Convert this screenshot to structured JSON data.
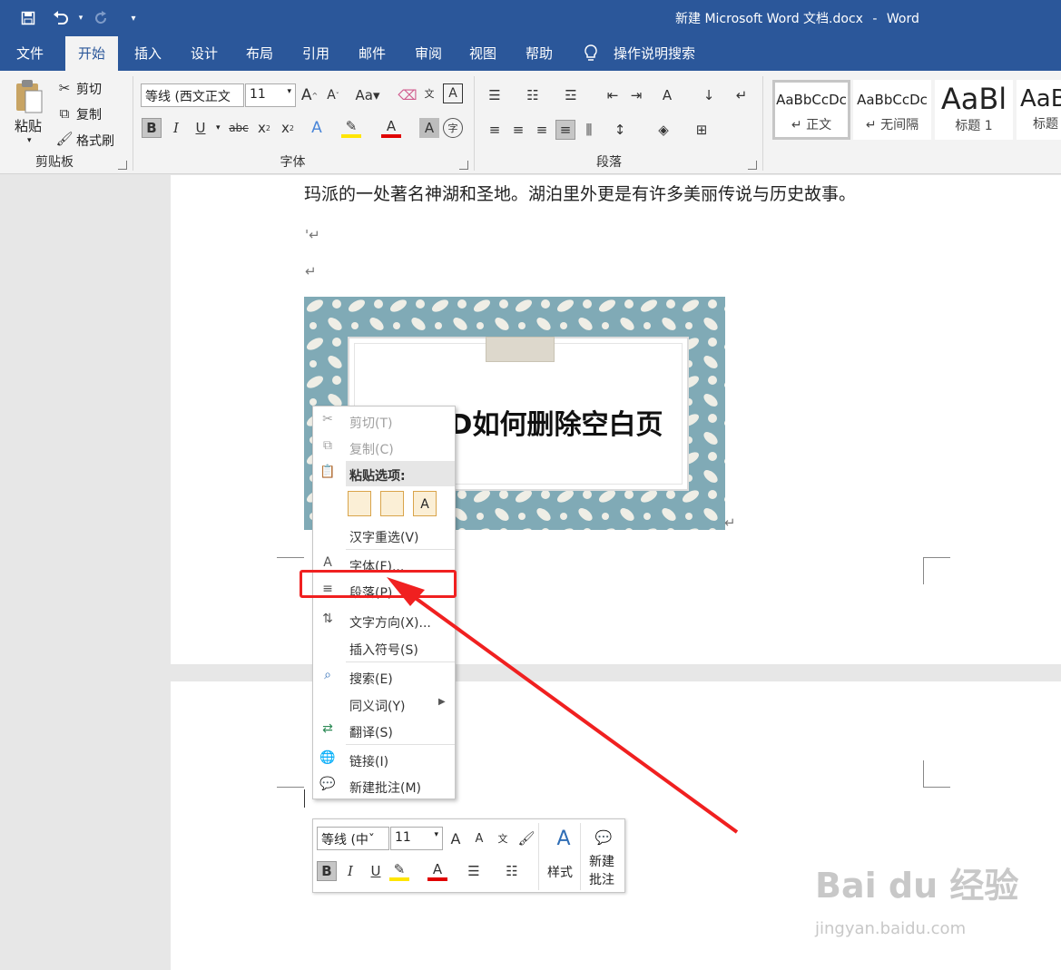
{
  "window": {
    "doc_title": "新建 Microsoft Word 文档.docx",
    "separator": "-",
    "app_name": "Word"
  },
  "qat": {
    "save_icon": "save-icon",
    "undo_icon": "undo-icon",
    "redo_icon": "redo-icon",
    "customize_icon": "customize-icon"
  },
  "tabs": [
    {
      "label": "文件"
    },
    {
      "label": "开始"
    },
    {
      "label": "插入"
    },
    {
      "label": "设计"
    },
    {
      "label": "布局"
    },
    {
      "label": "引用"
    },
    {
      "label": "邮件"
    },
    {
      "label": "审阅"
    },
    {
      "label": "视图"
    },
    {
      "label": "帮助"
    },
    {
      "label": "操作说明搜索"
    }
  ],
  "ribbon": {
    "clipboard": {
      "paste": "粘贴",
      "cut": "剪切",
      "copy": "复制",
      "format_painter": "格式刷",
      "label": "剪贴板"
    },
    "font": {
      "font_name": "等线 (西文正文",
      "font_size": "11",
      "label": "字体"
    },
    "paragraph": {
      "label": "段落"
    },
    "styles": [
      {
        "sample": "AaBbCcDc",
        "name": "↵ 正文"
      },
      {
        "sample": "AaBbCcDc",
        "name": "↵ 无间隔"
      },
      {
        "sample": "AaBl",
        "name": "标题 1"
      },
      {
        "sample": "AaB",
        "name": "标题"
      }
    ]
  },
  "document": {
    "line1": "玛派的一处著名神湖和圣地。湖泊里外更是有许多美丽传说与历史故事。",
    "line2": "'↵",
    "line3": "↵",
    "picture_title": "D如何删除空白页",
    "picture_mark": "↵"
  },
  "context_menu": {
    "items": [
      {
        "label": "剪切(T)"
      },
      {
        "label": "复制(C)"
      },
      {
        "label": "粘贴选项:"
      },
      {
        "label": "汉字重选(V)"
      },
      {
        "label": "字体(F)..."
      },
      {
        "label": "段落(P)..."
      },
      {
        "label": "文字方向(X)..."
      },
      {
        "label": "插入符号(S)"
      },
      {
        "label": "搜索(E)"
      },
      {
        "label": "同义词(Y)"
      },
      {
        "label": "翻译(S)"
      },
      {
        "label": "链接(I)"
      },
      {
        "label": "新建批注(M)"
      }
    ]
  },
  "mini_toolbar": {
    "font_name": "等线 (中ˇ",
    "font_size": "11",
    "styles_label": "样式",
    "new_comment_label_1": "新建",
    "new_comment_label_2": "批注"
  },
  "watermark": {
    "brand": "Bai du 经验",
    "url": "jingyan.baidu.com"
  },
  "colors": {
    "title_bar": "#2b579a",
    "annotation_red": "#f02020"
  }
}
